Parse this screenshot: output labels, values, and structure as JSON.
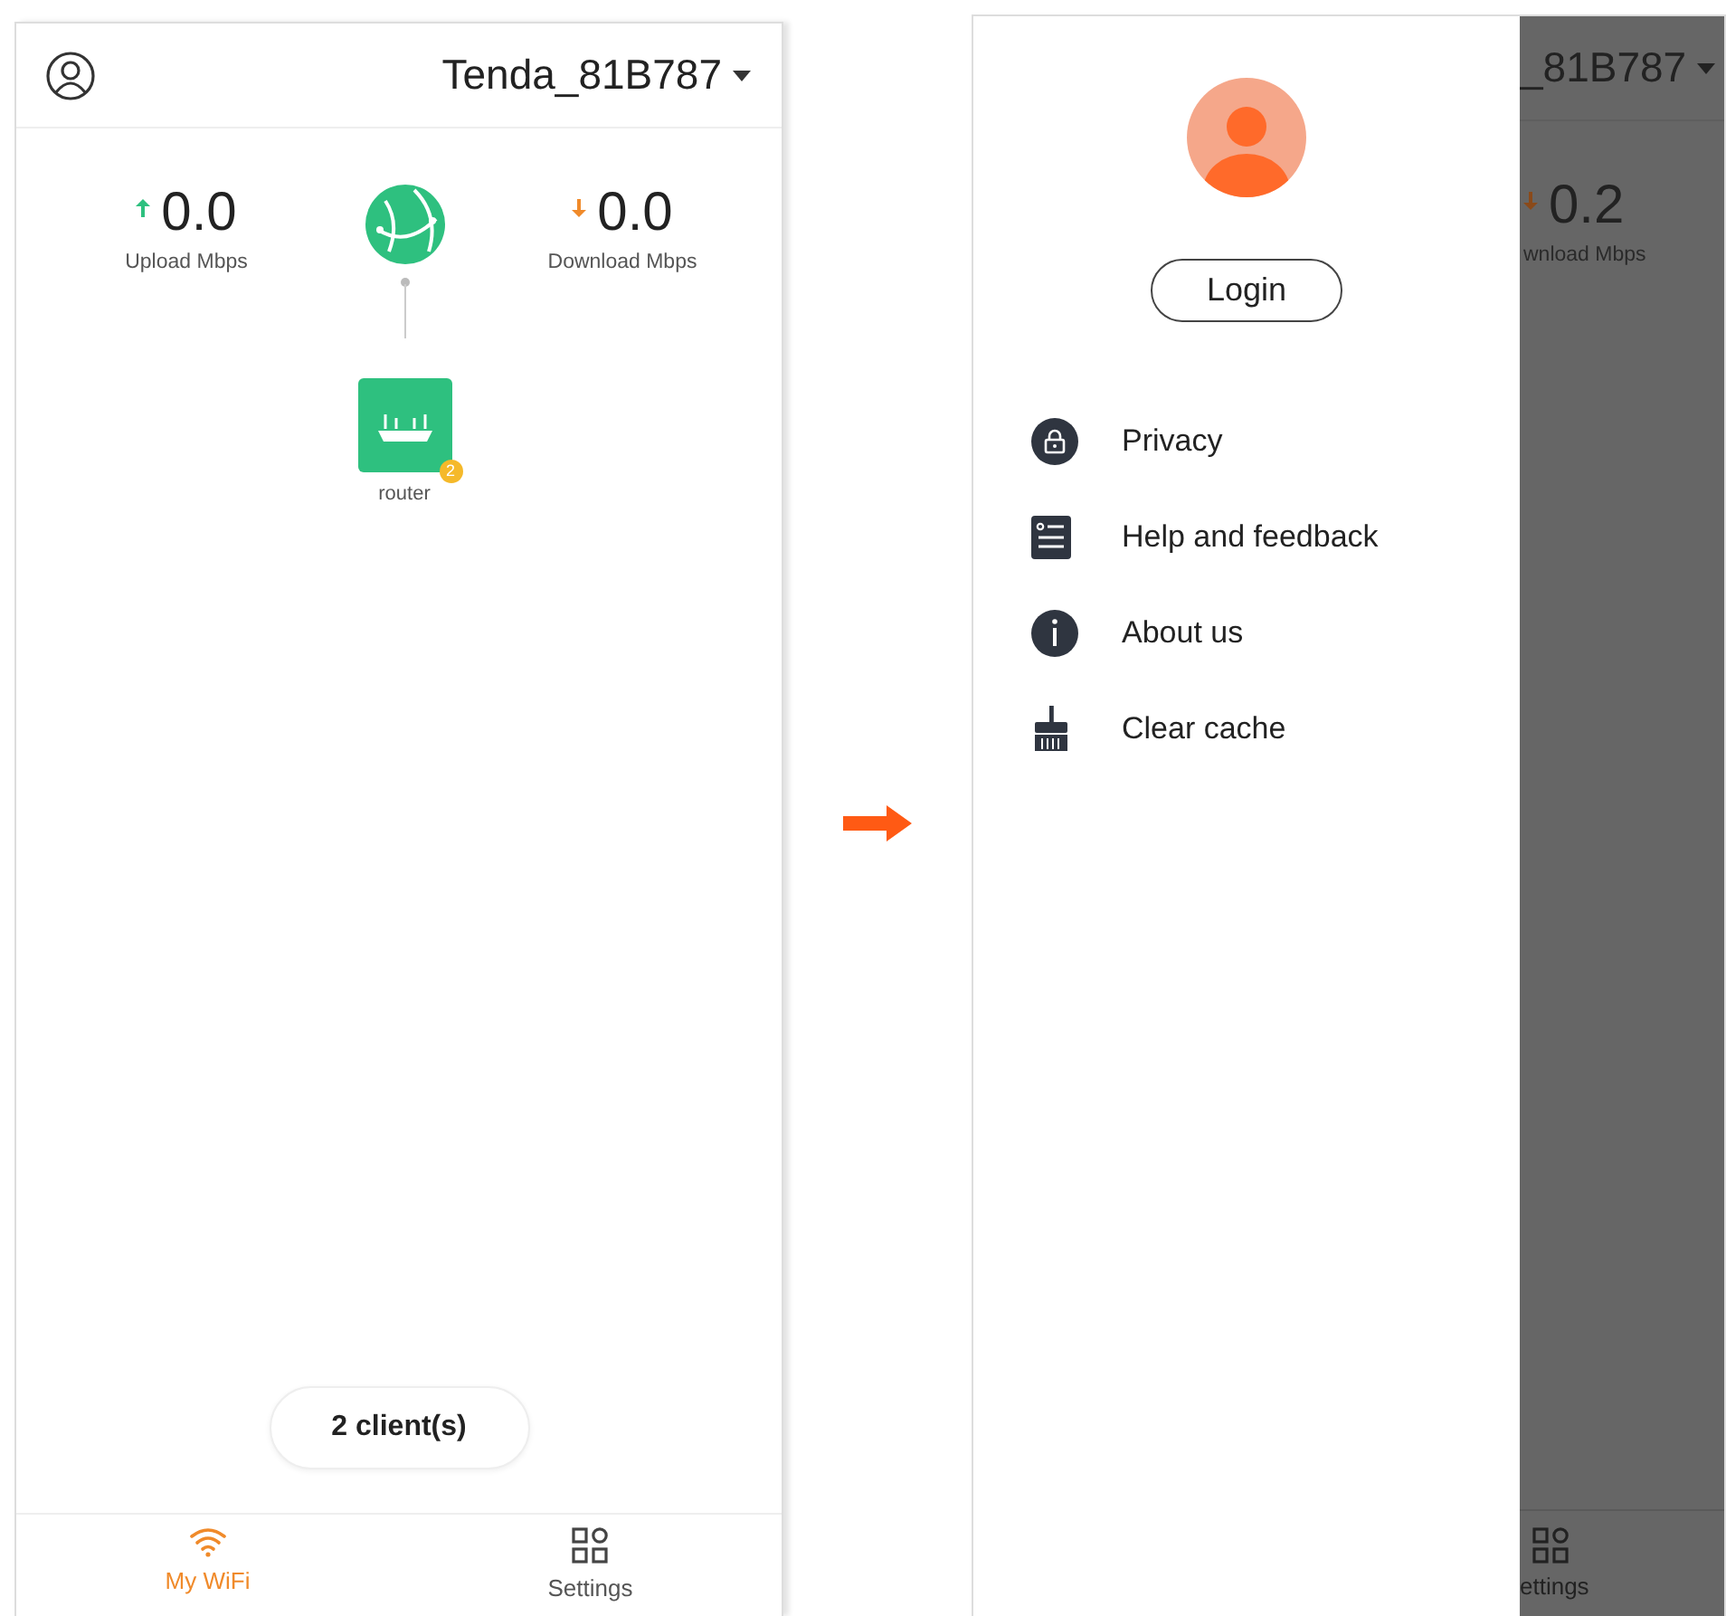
{
  "home": {
    "network_name": "Tenda_81B787",
    "upload": {
      "value": "0.0",
      "label": "Upload Mbps"
    },
    "download": {
      "value": "0.0",
      "label": "Download Mbps"
    },
    "router": {
      "label": "router",
      "badge": "2"
    },
    "clients": "2 client(s)",
    "tabs": [
      {
        "label": "My WiFi",
        "selected": true,
        "kind": "wifi"
      },
      {
        "label": "Settings",
        "selected": false,
        "kind": "grid"
      }
    ]
  },
  "menu_screen": {
    "behind": {
      "network_name": "_81B787",
      "download": {
        "value": "0.2",
        "label": "wnload Mbps"
      },
      "tab_label": "ettings"
    },
    "login": "Login",
    "menu": [
      {
        "label": "Privacy",
        "kind": "lock"
      },
      {
        "label": "Help and feedback",
        "kind": "list"
      },
      {
        "label": "About us",
        "kind": "info"
      },
      {
        "label": "Clear cache",
        "kind": "broom"
      }
    ]
  }
}
